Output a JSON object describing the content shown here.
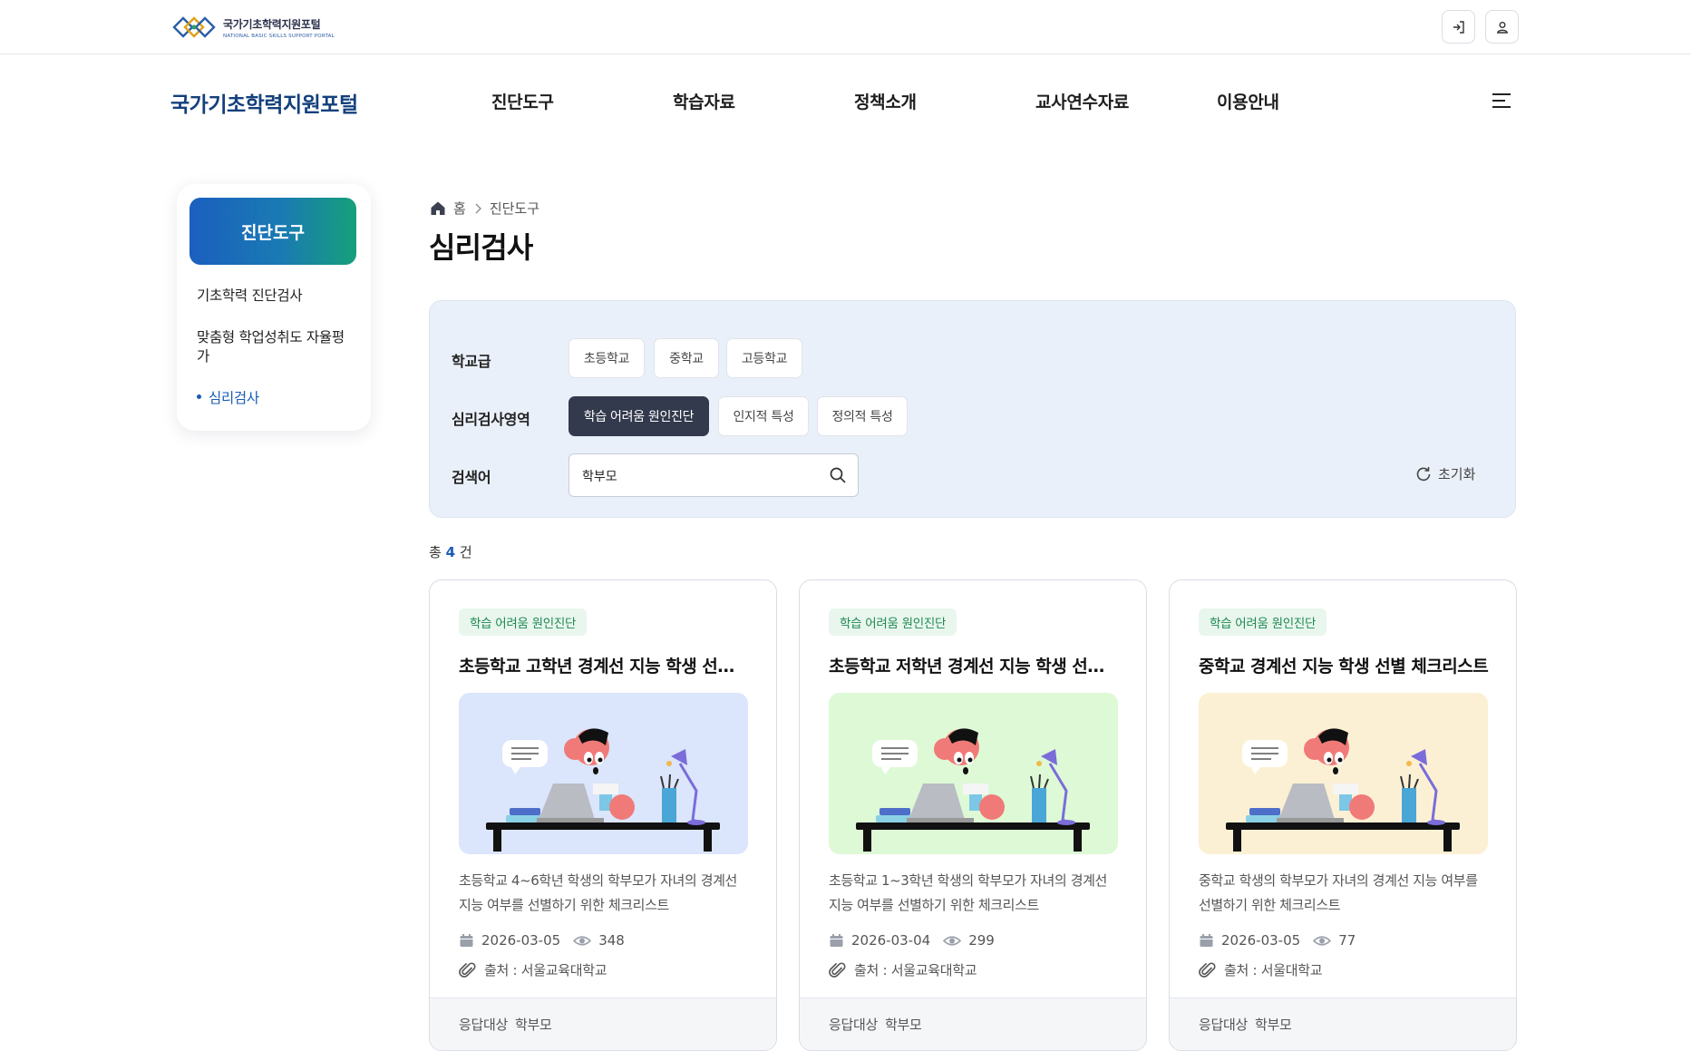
{
  "header": {
    "logo_kr": "국가기초학력지원포털",
    "logo_en": "NATIONAL BASIC SKILLS SUPPORT PORTAL",
    "site_title": "국가기초학력지원포털"
  },
  "nav": [
    "진단도구",
    "학습자료",
    "정책소개",
    "교사연수자료",
    "이용안내"
  ],
  "sidebar": {
    "heading": "진단도구",
    "items": [
      {
        "label": "기초학력 진단검사",
        "active": false
      },
      {
        "label": "맞춤형 학업성취도 자율평가",
        "active": false
      },
      {
        "label": "심리검사",
        "active": true
      }
    ]
  },
  "breadcrumb": {
    "home": "홈",
    "current": "진단도구"
  },
  "page_title": "심리검사",
  "filter": {
    "school_label": "학교급",
    "school_options": [
      "초등학교",
      "중학교",
      "고등학교"
    ],
    "area_label": "심리검사영역",
    "area_options": [
      {
        "label": "학습 어려움 원인진단",
        "selected": true
      },
      {
        "label": "인지적 특성",
        "selected": false
      },
      {
        "label": "정의적 특성",
        "selected": false
      }
    ],
    "search_label": "검색어",
    "search_value": "학부모",
    "reset_label": "초기화"
  },
  "total": {
    "prefix": "총",
    "count": "4",
    "suffix": "건"
  },
  "cards": [
    {
      "badge": "학습 어려움 원인진단",
      "title": "초등학교 고학년 경계선 지능 학생 선별 체크리스트",
      "thumb_bg": "#dbe5fb",
      "desc": "초등학교 4~6학년 학생의 학부모가 자녀의 경계선 지능 여부를 선별하기 위한 체크리스트",
      "date": "2026-03-05",
      "views": "348",
      "source": "출처 : 서울교육대학교",
      "foot_label": "응답대상",
      "foot_value": "학부모"
    },
    {
      "badge": "학습 어려움 원인진단",
      "title": "초등학교 저학년 경계선 지능 학생 선별 체크리스트",
      "thumb_bg": "#def9d6",
      "desc": "초등학교 1~3학년 학생의 학부모가 자녀의 경계선 지능 여부를 선별하기 위한 체크리스트",
      "date": "2026-03-04",
      "views": "299",
      "source": "출처 : 서울교육대학교",
      "foot_label": "응답대상",
      "foot_value": "학부모"
    },
    {
      "badge": "학습 어려움 원인진단",
      "title": "중학교 경계선 지능 학생 선별 체크리스트",
      "thumb_bg": "#fcf0d4",
      "desc": "중학교 학생의 학부모가 자녀의 경계선 지능 여부를 선별하기 위한 체크리스트",
      "date": "2026-03-05",
      "views": "77",
      "source": "출처 : 서울대학교",
      "foot_label": "응답대상",
      "foot_value": "학부모"
    }
  ]
}
